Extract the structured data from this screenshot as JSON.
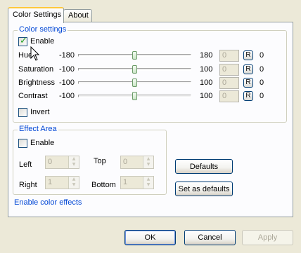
{
  "tabs": [
    "Color Settings",
    "About"
  ],
  "color_settings": {
    "title": "Color settings",
    "enable_label": "Enable",
    "enable_checked": true,
    "sliders": [
      {
        "label": "Hue",
        "min": "-180",
        "max": "180",
        "value": "0",
        "reset": "R",
        "readout": "0",
        "level": 0.5
      },
      {
        "label": "Saturation",
        "min": "-100",
        "max": "100",
        "value": "0",
        "reset": "R",
        "readout": "0",
        "level": 0.5
      },
      {
        "label": "Brightness",
        "min": "-100",
        "max": "100",
        "value": "0",
        "reset": "R",
        "readout": "0",
        "level": 0.5
      },
      {
        "label": "Contrast",
        "min": "-100",
        "max": "100",
        "value": "0",
        "reset": "R",
        "readout": "0",
        "level": 0.5
      }
    ],
    "invert_label": "Invert",
    "invert_checked": false
  },
  "effect_area": {
    "title": "Effect Area",
    "enable_label": "Enable",
    "enable_checked": false,
    "left_label": "Left",
    "left_value": "0",
    "top_label": "Top",
    "top_value": "0",
    "right_label": "Right",
    "right_value": "1",
    "bottom_label": "Bottom",
    "bottom_value": "1"
  },
  "buttons": {
    "defaults": "Defaults",
    "set_as_defaults": "Set as defaults",
    "ok": "OK",
    "cancel": "Cancel",
    "apply": "Apply"
  },
  "status_text": "Enable color effects",
  "colors": {
    "group_title": "#0046d5",
    "status": "#0046d5",
    "window_bg": "#ece9d8"
  }
}
